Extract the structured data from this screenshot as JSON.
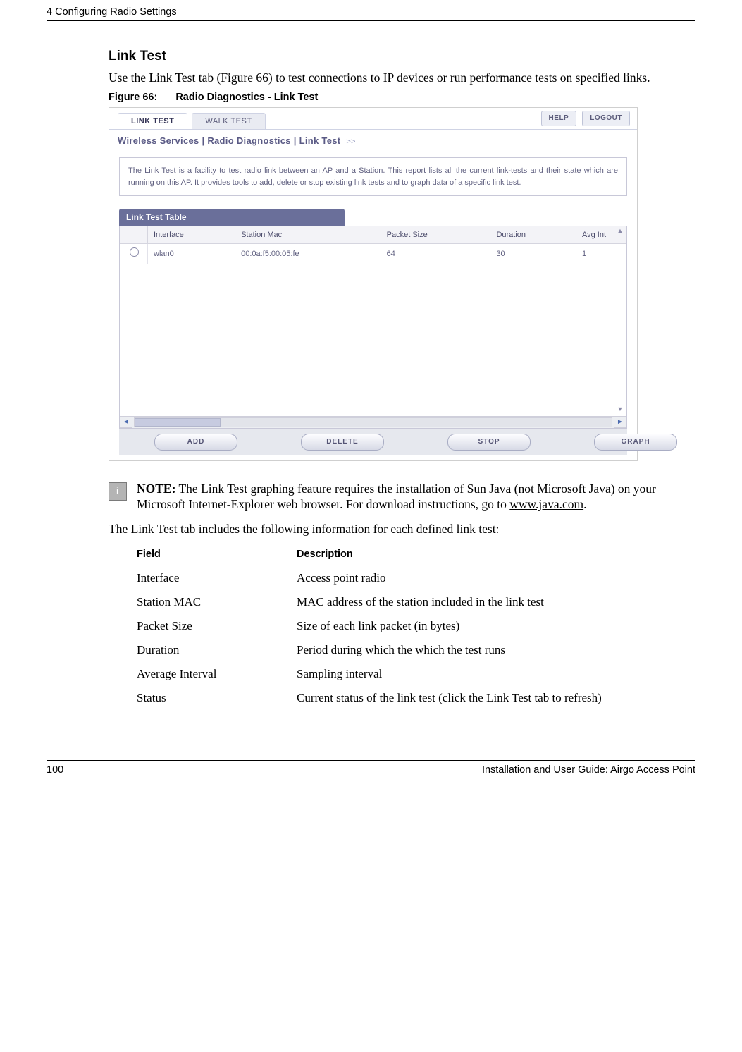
{
  "header": {
    "chapter": "4  Configuring Radio Settings"
  },
  "section": {
    "title": "Link Test",
    "intro": "Use the Link Test tab (Figure 66) to test connections to IP devices or run performance tests on specified links."
  },
  "figure": {
    "label": "Figure 66:",
    "title": "Radio Diagnostics - Link Test"
  },
  "ui": {
    "tabs": {
      "link": "LINK TEST",
      "walk": "WALK TEST"
    },
    "buttons": {
      "help": "HELP",
      "logout": "LOGOUT"
    },
    "breadcrumb": "Wireless Services | Radio Diagnostics | Link Test  ",
    "breadcrumb_chevron": ">>",
    "panel_text": "The Link Test is a facility to test radio link between an AP and a Station. This report lists all the current link-tests and their state which are running on this AP. It provides tools to add, delete or stop existing link tests and to graph data of a specific link test.",
    "table_title": "Link Test Table",
    "table": {
      "headers": {
        "interface": "Interface",
        "mac": "Station Mac",
        "packet_size": "Packet Size",
        "duration": "Duration",
        "avg": "Avg Int"
      },
      "rows": [
        {
          "interface": "wlan0",
          "mac": "00:0a:f5:00:05:fe",
          "packet_size": "64",
          "duration": "30",
          "avg": "1"
        }
      ]
    },
    "footer_buttons": {
      "add": "ADD",
      "delete": "DELETE",
      "stop": "STOP",
      "graph": "GRAPH"
    }
  },
  "note": {
    "label": "NOTE:",
    "text_a": " The Link Test graphing feature requires the installation of Sun Java (not Microsoft Java) on your Microsoft Internet-Explorer web browser. For download instructions, go to ",
    "link": "www.java.com",
    "text_b": "."
  },
  "lead": "The Link Test tab includes the following information for each defined link test:",
  "dtable": {
    "h1": "Field",
    "h2": "Description",
    "rows": [
      {
        "f": "Interface",
        "d": "Access point radio"
      },
      {
        "f": "Station MAC",
        "d": "MAC address of the station included in the link test"
      },
      {
        "f": "Packet Size",
        "d": "Size of each link packet (in bytes)"
      },
      {
        "f": "Duration",
        "d": "Period during which the which the test runs"
      },
      {
        "f": "Average Interval",
        "d": "Sampling interval"
      },
      {
        "f": "Status",
        "d": "Current status of the link test (click the Link Test tab to refresh)"
      }
    ]
  },
  "footer": {
    "page": "100",
    "doc": "Installation and User Guide: Airgo Access Point"
  }
}
